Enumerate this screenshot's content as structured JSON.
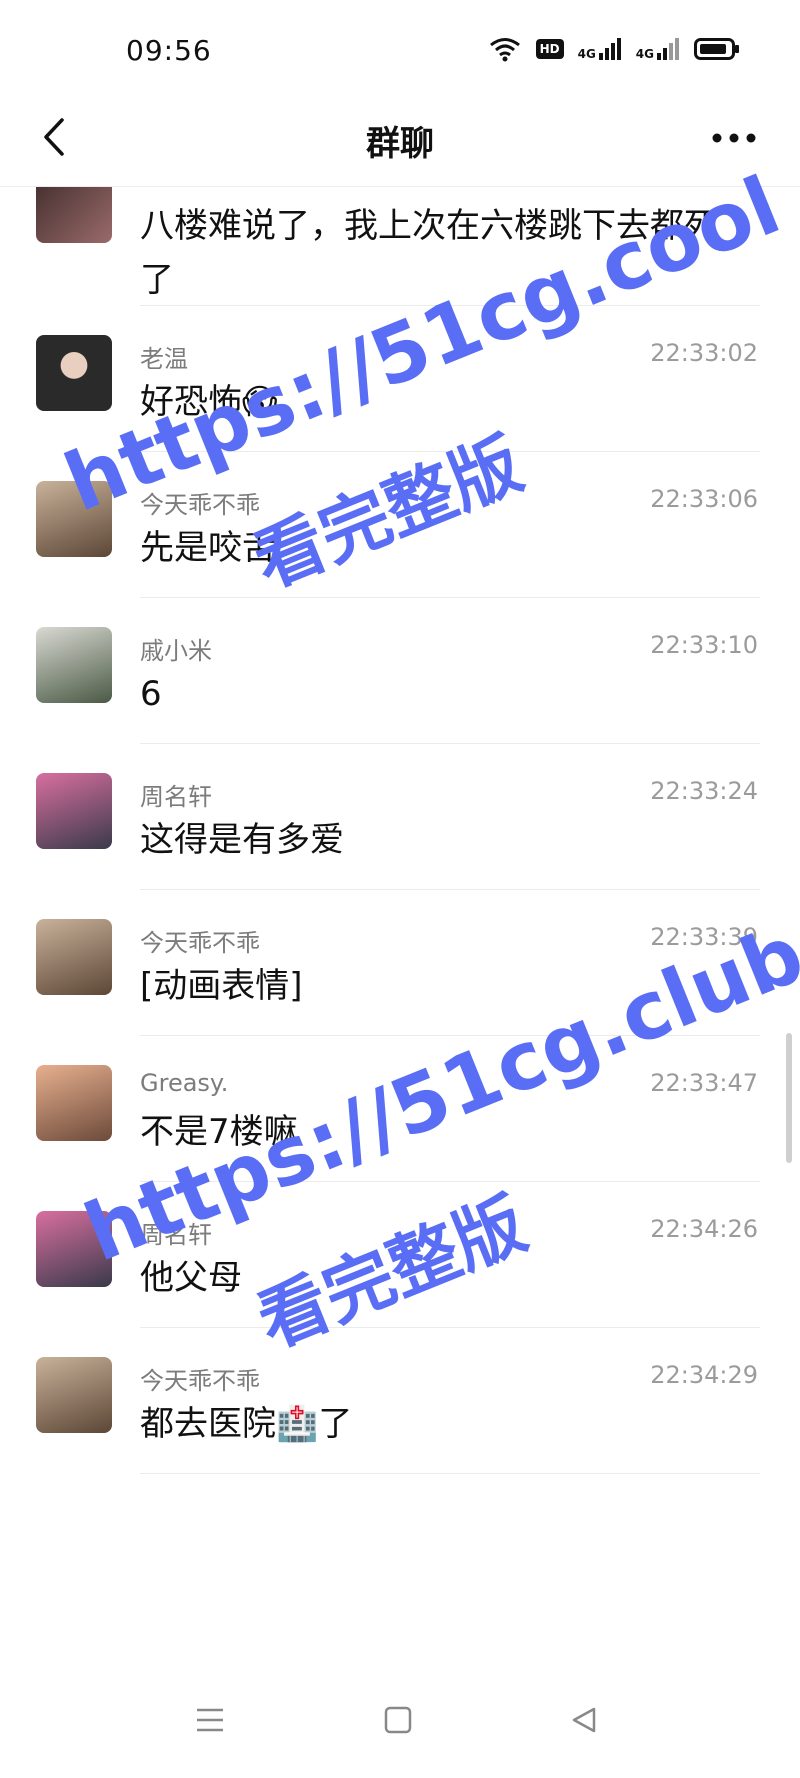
{
  "status_bar": {
    "time": "09:56",
    "hd_label": "HD",
    "net1": "4G",
    "net2": "4G"
  },
  "nav": {
    "title": "群聊"
  },
  "messages": [
    {
      "sender": "",
      "time": "",
      "text": "八楼难说了，我上次在六楼跳下去都死了",
      "avatar_color": "#6b4a4a"
    },
    {
      "sender": "老温",
      "time": "22:33:02",
      "text": "好恐怖😱",
      "avatar_color": "#3a3a3a"
    },
    {
      "sender": "今天乖不乖",
      "time": "22:33:06",
      "text": "先是咬舌",
      "avatar_color": "#8a7460"
    },
    {
      "sender": "戚小米",
      "time": "22:33:10",
      "text": "6",
      "avatar_color": "#5d6b55"
    },
    {
      "sender": "周名轩",
      "time": "22:33:24",
      "text": "这得是有多爱",
      "avatar_color": "#a05c7a"
    },
    {
      "sender": "今天乖不乖",
      "time": "22:33:39",
      "text": "[动画表情]",
      "avatar_color": "#8a7460"
    },
    {
      "sender": "Greasy.",
      "time": "22:33:47",
      "text": "不是7楼嘛",
      "avatar_color": "#c08a70"
    },
    {
      "sender": "周名轩",
      "time": "22:34:26",
      "text": "他父母",
      "avatar_color": "#a05c7a"
    },
    {
      "sender": "今天乖不乖",
      "time": "22:34:29",
      "text": "都去医院🏥了",
      "avatar_color": "#8a7460"
    }
  ],
  "watermarks": [
    {
      "url": "https://51cg.cool",
      "sub": "看完整版"
    },
    {
      "url": "https://51cg.club",
      "sub": "看完整版"
    }
  ],
  "colors": {
    "watermark": "#5a6ef5",
    "divider": "#ebebeb",
    "sender": "#7c7c7c"
  }
}
